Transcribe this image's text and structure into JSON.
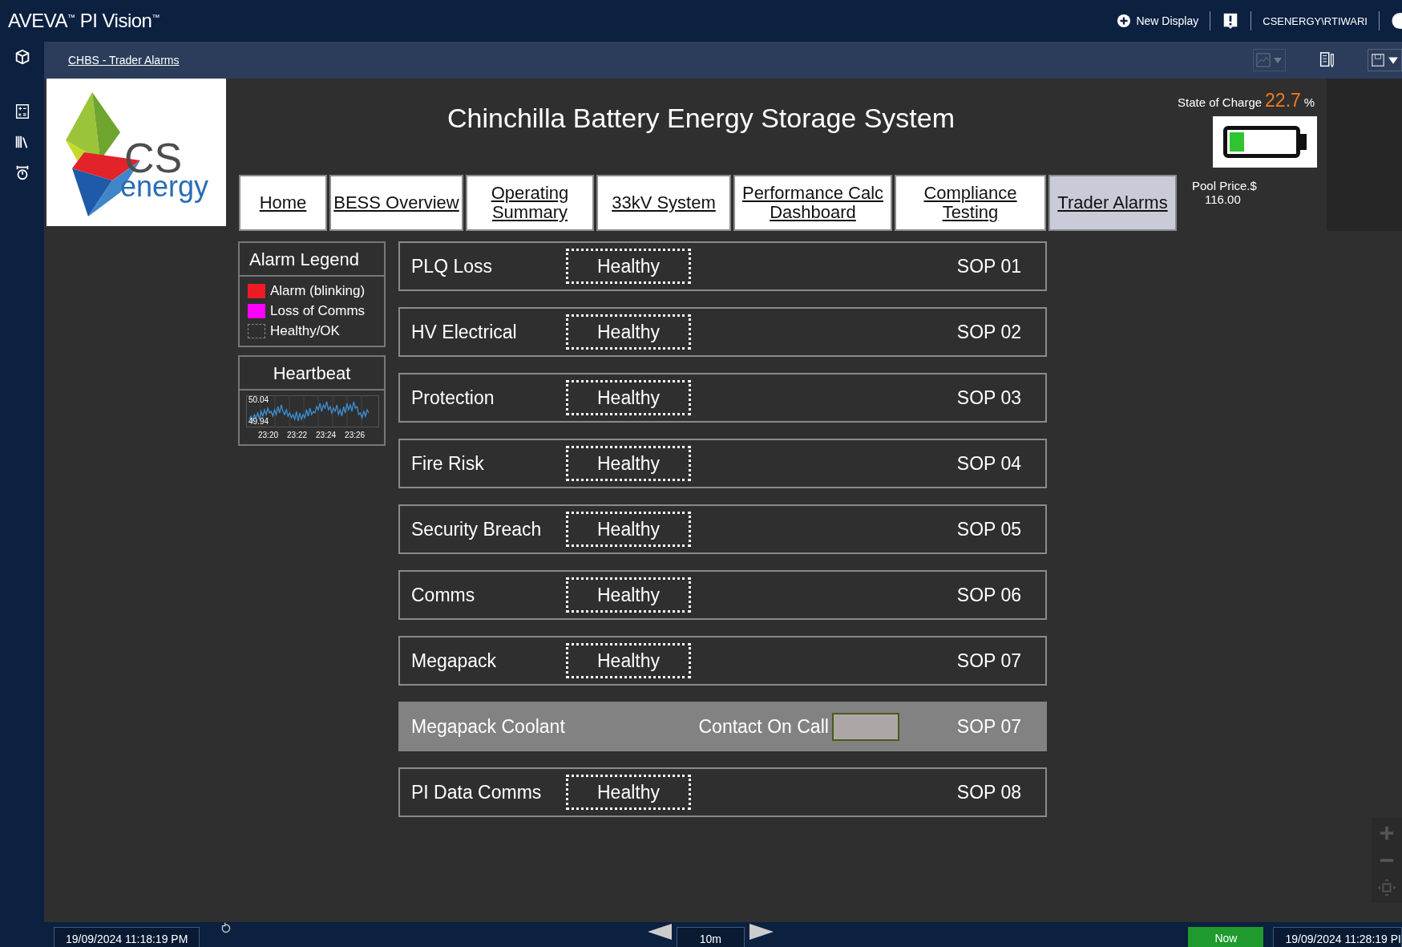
{
  "app": {
    "title": "AVEVA$^{™}$ PI Vision$^{™}$",
    "new_display": "New Display",
    "user": "CSENERGY\\RTIWARI"
  },
  "breadcrumb": "CHBS - Trader Alarms",
  "logo": {
    "text": "CS",
    "subtext": "energy"
  },
  "header": {
    "title": "Chinchilla Battery Energy Storage System"
  },
  "nav": [
    {
      "lines": [
        "Home"
      ],
      "selected": false
    },
    {
      "lines": [
        "BESS Overview"
      ],
      "selected": false
    },
    {
      "lines": [
        "Operating",
        "Summary"
      ],
      "selected": false
    },
    {
      "lines": [
        "33kV System"
      ],
      "selected": false
    },
    {
      "lines": [
        "Performance Calc",
        "Dashboard"
      ],
      "selected": false
    },
    {
      "lines": [
        "Compliance",
        "Testing"
      ],
      "selected": false
    },
    {
      "lines": [
        "Trader Alarms"
      ],
      "selected": true
    }
  ],
  "state_of_charge": {
    "label": "State of Charge",
    "value": "22.7",
    "unit": "%",
    "level": 0.227
  },
  "pool_price": {
    "label": "Pool Price.$",
    "value": "116.00"
  },
  "legend": {
    "title": "Alarm Legend",
    "items": [
      {
        "label": "Alarm (blinking)",
        "kind": "fill",
        "color": "#ed1c24"
      },
      {
        "label": "Loss of Comms",
        "kind": "fill",
        "color": "#ff00ff"
      },
      {
        "label": "Healthy/OK",
        "kind": "outline"
      }
    ]
  },
  "heartbeat": {
    "title": "Heartbeat",
    "y_labels": [
      "50.04",
      "49.94"
    ],
    "x_labels": [
      "23:20",
      "23:22",
      "23:24",
      "23:26"
    ]
  },
  "alarms": [
    {
      "name": "PLQ Loss",
      "kind": "healthy",
      "status": "Healthy",
      "sop": "SOP 01"
    },
    {
      "name": "HV Electrical",
      "kind": "healthy",
      "status": "Healthy",
      "sop": "SOP 02"
    },
    {
      "name": "Protection",
      "kind": "healthy",
      "status": "Healthy",
      "sop": "SOP 03"
    },
    {
      "name": "Fire Risk",
      "kind": "healthy",
      "status": "Healthy",
      "sop": "SOP 04"
    },
    {
      "name": "Security Breach",
      "kind": "healthy",
      "status": "Healthy",
      "sop": "SOP 05"
    },
    {
      "name": "Comms",
      "kind": "healthy",
      "status": "Healthy",
      "sop": "SOP 06"
    },
    {
      "name": "Megapack",
      "kind": "healthy",
      "status": "Healthy",
      "sop": "SOP 07"
    },
    {
      "name": "Megapack Coolant",
      "kind": "contact",
      "status": "Contact On Call",
      "sop": "SOP 07"
    },
    {
      "name": "PI Data Comms",
      "kind": "healthy",
      "status": "Healthy",
      "sop": "SOP 08"
    }
  ],
  "time_bar": {
    "start": "19/09/2024 11:18:19 PM",
    "span": "10m",
    "now": "Now",
    "end": "19/09/2024 11:28:19 PI"
  }
}
